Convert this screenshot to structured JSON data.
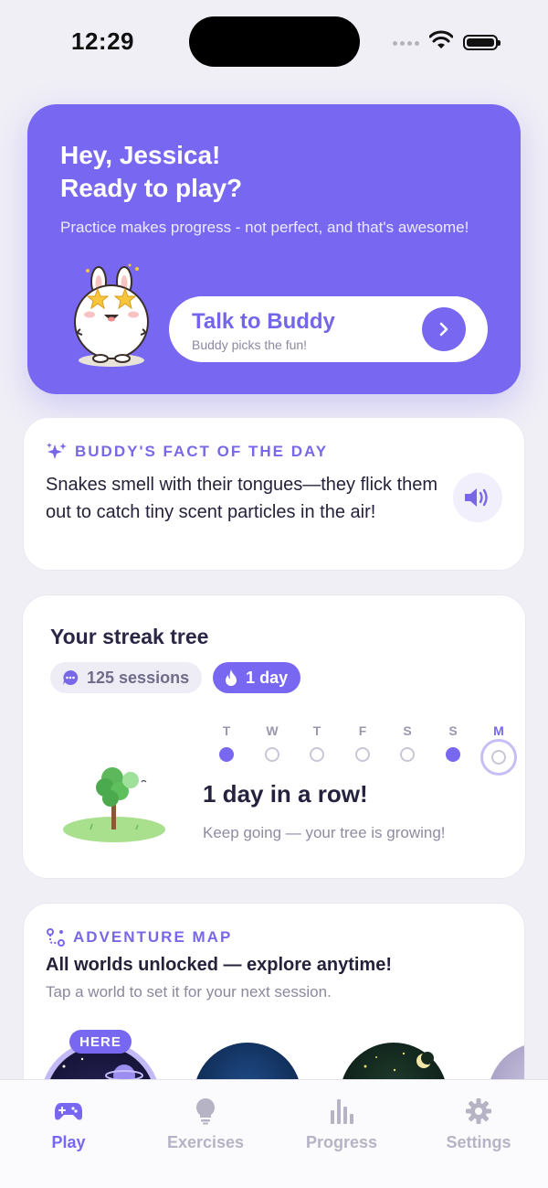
{
  "status_bar": {
    "time": "12:29"
  },
  "hero": {
    "greeting_line1": "Hey, Jessica!",
    "greeting_line2": "Ready to play?",
    "subtitle": "Practice makes progress - not perfect, and that's awesome!",
    "cta": {
      "title": "Talk to Buddy",
      "subtitle": "Buddy picks the fun!"
    }
  },
  "fact": {
    "label": "BUDDY'S FACT OF THE DAY",
    "text": "Snakes smell with their tongues—they flick them out to catch tiny scent particles in the air!"
  },
  "streak": {
    "title": "Your streak tree",
    "sessions_chip": "125 sessions",
    "days_chip": "1 day",
    "week": [
      {
        "letter": "T",
        "done": true
      },
      {
        "letter": "W",
        "done": false
      },
      {
        "letter": "T",
        "done": false
      },
      {
        "letter": "F",
        "done": false
      },
      {
        "letter": "S",
        "done": false
      },
      {
        "letter": "S",
        "done": true
      },
      {
        "letter": "M",
        "done": false,
        "today": true
      }
    ],
    "headline": "1 day in a row!",
    "message": "Keep going — your tree is growing!"
  },
  "adventure": {
    "label": "ADVENTURE MAP",
    "title": "All worlds unlocked — explore anytime!",
    "subtitle": "Tap a world to set it for your next session.",
    "here_badge": "HERE"
  },
  "tabs": [
    {
      "label": "Play",
      "icon": "gamepad-icon",
      "active": true
    },
    {
      "label": "Exercises",
      "icon": "lightbulb-icon",
      "active": false
    },
    {
      "label": "Progress",
      "icon": "bar-chart-icon",
      "active": false
    },
    {
      "label": "Settings",
      "icon": "gear-icon",
      "active": false
    }
  ],
  "colors": {
    "accent": "#7868f1",
    "background": "#f0eff6"
  }
}
